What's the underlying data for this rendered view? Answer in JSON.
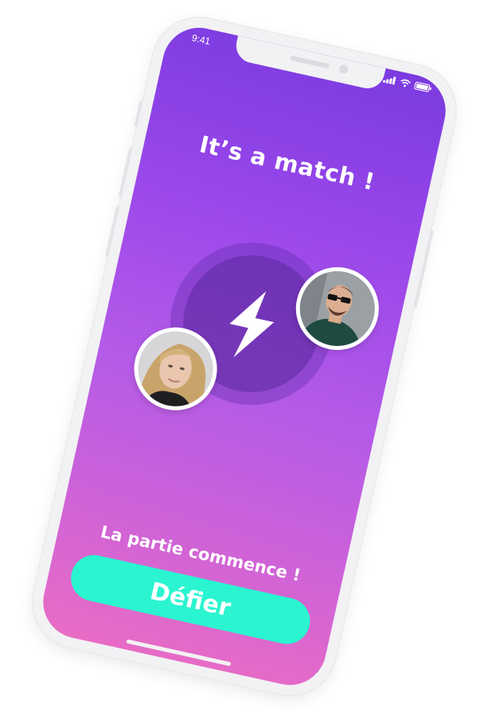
{
  "status_bar": {
    "time": "9:41",
    "icons": [
      "signal-icon",
      "wifi-icon",
      "battery-icon"
    ]
  },
  "match": {
    "title": "It’s a match !",
    "center_icon": "lightning-bolt-icon",
    "avatars": [
      "avatar-woman",
      "avatar-man"
    ]
  },
  "footer": {
    "subtitle": "La partie commence !",
    "cta_label": "Défier"
  },
  "colors": {
    "gradient_top": "#7b3be0",
    "gradient_bottom": "#e96cc4",
    "cta": "#2af5d0",
    "text": "#ffffff"
  }
}
